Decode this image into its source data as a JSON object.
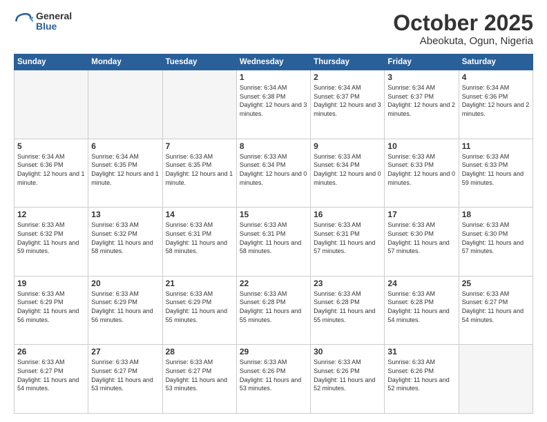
{
  "header": {
    "logo_general": "General",
    "logo_blue": "Blue",
    "month_title": "October 2025",
    "location": "Abeokuta, Ogun, Nigeria"
  },
  "weekdays": [
    "Sunday",
    "Monday",
    "Tuesday",
    "Wednesday",
    "Thursday",
    "Friday",
    "Saturday"
  ],
  "weeks": [
    [
      {
        "day": "",
        "empty": true
      },
      {
        "day": "",
        "empty": true
      },
      {
        "day": "",
        "empty": true
      },
      {
        "day": "1",
        "sunrise": "6:34 AM",
        "sunset": "6:38 PM",
        "daylight": "12 hours and 3 minutes."
      },
      {
        "day": "2",
        "sunrise": "6:34 AM",
        "sunset": "6:37 PM",
        "daylight": "12 hours and 3 minutes."
      },
      {
        "day": "3",
        "sunrise": "6:34 AM",
        "sunset": "6:37 PM",
        "daylight": "12 hours and 2 minutes."
      },
      {
        "day": "4",
        "sunrise": "6:34 AM",
        "sunset": "6:36 PM",
        "daylight": "12 hours and 2 minutes."
      }
    ],
    [
      {
        "day": "5",
        "sunrise": "6:34 AM",
        "sunset": "6:36 PM",
        "daylight": "12 hours and 1 minute."
      },
      {
        "day": "6",
        "sunrise": "6:34 AM",
        "sunset": "6:35 PM",
        "daylight": "12 hours and 1 minute."
      },
      {
        "day": "7",
        "sunrise": "6:33 AM",
        "sunset": "6:35 PM",
        "daylight": "12 hours and 1 minute."
      },
      {
        "day": "8",
        "sunrise": "6:33 AM",
        "sunset": "6:34 PM",
        "daylight": "12 hours and 0 minutes."
      },
      {
        "day": "9",
        "sunrise": "6:33 AM",
        "sunset": "6:34 PM",
        "daylight": "12 hours and 0 minutes."
      },
      {
        "day": "10",
        "sunrise": "6:33 AM",
        "sunset": "6:33 PM",
        "daylight": "12 hours and 0 minutes."
      },
      {
        "day": "11",
        "sunrise": "6:33 AM",
        "sunset": "6:33 PM",
        "daylight": "11 hours and 59 minutes."
      }
    ],
    [
      {
        "day": "12",
        "sunrise": "6:33 AM",
        "sunset": "6:32 PM",
        "daylight": "11 hours and 59 minutes."
      },
      {
        "day": "13",
        "sunrise": "6:33 AM",
        "sunset": "6:32 PM",
        "daylight": "11 hours and 58 minutes."
      },
      {
        "day": "14",
        "sunrise": "6:33 AM",
        "sunset": "6:31 PM",
        "daylight": "11 hours and 58 minutes."
      },
      {
        "day": "15",
        "sunrise": "6:33 AM",
        "sunset": "6:31 PM",
        "daylight": "11 hours and 58 minutes."
      },
      {
        "day": "16",
        "sunrise": "6:33 AM",
        "sunset": "6:31 PM",
        "daylight": "11 hours and 57 minutes."
      },
      {
        "day": "17",
        "sunrise": "6:33 AM",
        "sunset": "6:30 PM",
        "daylight": "11 hours and 57 minutes."
      },
      {
        "day": "18",
        "sunrise": "6:33 AM",
        "sunset": "6:30 PM",
        "daylight": "11 hours and 57 minutes."
      }
    ],
    [
      {
        "day": "19",
        "sunrise": "6:33 AM",
        "sunset": "6:29 PM",
        "daylight": "11 hours and 56 minutes."
      },
      {
        "day": "20",
        "sunrise": "6:33 AM",
        "sunset": "6:29 PM",
        "daylight": "11 hours and 56 minutes."
      },
      {
        "day": "21",
        "sunrise": "6:33 AM",
        "sunset": "6:29 PM",
        "daylight": "11 hours and 55 minutes."
      },
      {
        "day": "22",
        "sunrise": "6:33 AM",
        "sunset": "6:28 PM",
        "daylight": "11 hours and 55 minutes."
      },
      {
        "day": "23",
        "sunrise": "6:33 AM",
        "sunset": "6:28 PM",
        "daylight": "11 hours and 55 minutes."
      },
      {
        "day": "24",
        "sunrise": "6:33 AM",
        "sunset": "6:28 PM",
        "daylight": "11 hours and 54 minutes."
      },
      {
        "day": "25",
        "sunrise": "6:33 AM",
        "sunset": "6:27 PM",
        "daylight": "11 hours and 54 minutes."
      }
    ],
    [
      {
        "day": "26",
        "sunrise": "6:33 AM",
        "sunset": "6:27 PM",
        "daylight": "11 hours and 54 minutes."
      },
      {
        "day": "27",
        "sunrise": "6:33 AM",
        "sunset": "6:27 PM",
        "daylight": "11 hours and 53 minutes."
      },
      {
        "day": "28",
        "sunrise": "6:33 AM",
        "sunset": "6:27 PM",
        "daylight": "11 hours and 53 minutes."
      },
      {
        "day": "29",
        "sunrise": "6:33 AM",
        "sunset": "6:26 PM",
        "daylight": "11 hours and 53 minutes."
      },
      {
        "day": "30",
        "sunrise": "6:33 AM",
        "sunset": "6:26 PM",
        "daylight": "11 hours and 52 minutes."
      },
      {
        "day": "31",
        "sunrise": "6:33 AM",
        "sunset": "6:26 PM",
        "daylight": "11 hours and 52 minutes."
      },
      {
        "day": "",
        "empty": true
      }
    ]
  ]
}
